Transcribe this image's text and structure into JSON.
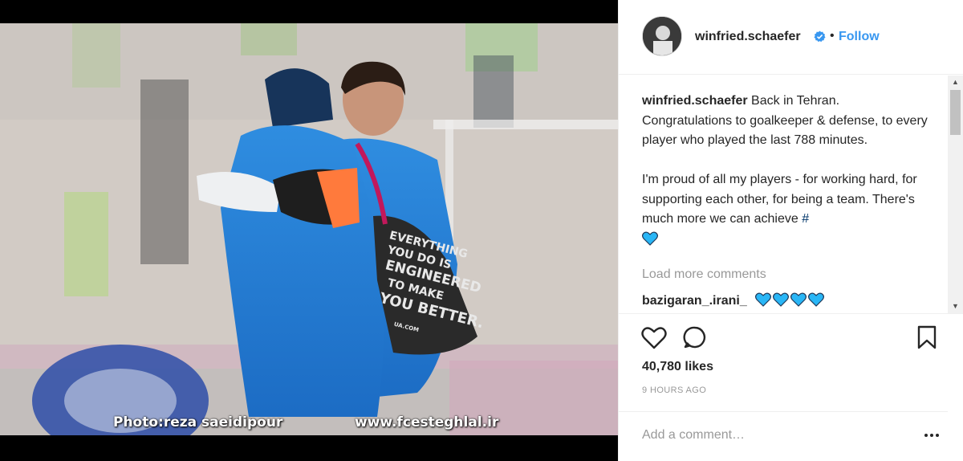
{
  "header": {
    "username": "winfried.schaefer",
    "separator": "•",
    "follow_label": "Follow",
    "verified_icon": "verified-badge-icon"
  },
  "photo": {
    "credit": "Photo:reza saeidipour",
    "site": "www.fcesteghlal.ir",
    "bag_text": [
      "EVERYTHING",
      "YOU DO IS",
      "ENGINEERED",
      "TO MAKE",
      "YOU BETTER."
    ],
    "bag_small": "UA.COM"
  },
  "caption": {
    "username": "winfried.schaefer",
    "para1": " Back in Tehran. Congratulations to goalkeeper & defense, to every player who played the last 788 minutes.",
    "para2": "I'm proud of all my players - for working hard, for supporting each other, for being a team. There's much more we can achieve ",
    "hashtag": "#"
  },
  "comments": {
    "load_more": "Load more comments",
    "reply_username": "bazigaran_.irani_",
    "reply_hearts": 4
  },
  "actions": {
    "likes": "40,780 likes",
    "time": "9 HOURS AGO"
  },
  "add_comment": {
    "placeholder": "Add a comment…"
  },
  "colors": {
    "follow": "#3897f0",
    "verified": "#3897f0",
    "heart_emoji": "#29b6f6",
    "muted": "#999999"
  }
}
